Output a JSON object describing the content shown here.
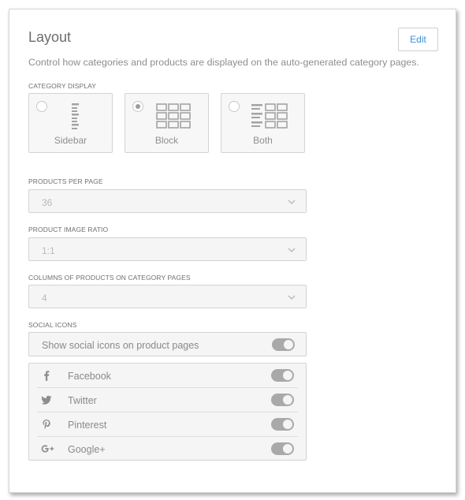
{
  "header": {
    "title": "Layout",
    "edit_label": "Edit"
  },
  "description": "Control how categories and products are displayed on the auto-generated category pages.",
  "category_display": {
    "label": "CATEGORY DISPLAY",
    "options": [
      {
        "label": "Sidebar",
        "selected": false,
        "icon": "sidebar-layout-icon"
      },
      {
        "label": "Block",
        "selected": true,
        "icon": "block-grid-icon"
      },
      {
        "label": "Both",
        "selected": false,
        "icon": "sidebar-and-grid-icon"
      }
    ]
  },
  "products_per_page": {
    "label": "PRODUCTS PER PAGE",
    "value": "36"
  },
  "image_ratio": {
    "label": "PRODUCT IMAGE RATIO",
    "value": "1:1"
  },
  "columns": {
    "label": "COLUMNS OF PRODUCTS ON CATEGORY PAGES",
    "value": "4"
  },
  "social": {
    "label": "SOCIAL ICONS",
    "main_toggle_label": "Show social icons on product pages",
    "main_toggle_on": true,
    "networks": [
      {
        "name": "Facebook",
        "icon": "facebook-icon",
        "on": true
      },
      {
        "name": "Twitter",
        "icon": "twitter-icon",
        "on": true
      },
      {
        "name": "Pinterest",
        "icon": "pinterest-icon",
        "on": true
      },
      {
        "name": "Google+",
        "icon": "google-plus-icon",
        "on": true
      }
    ]
  },
  "colors": {
    "accent": "#3a8fd8",
    "toggle_on": "#a9a9a9",
    "border": "#d3d3d3",
    "field_bg": "#f5f5f5"
  }
}
